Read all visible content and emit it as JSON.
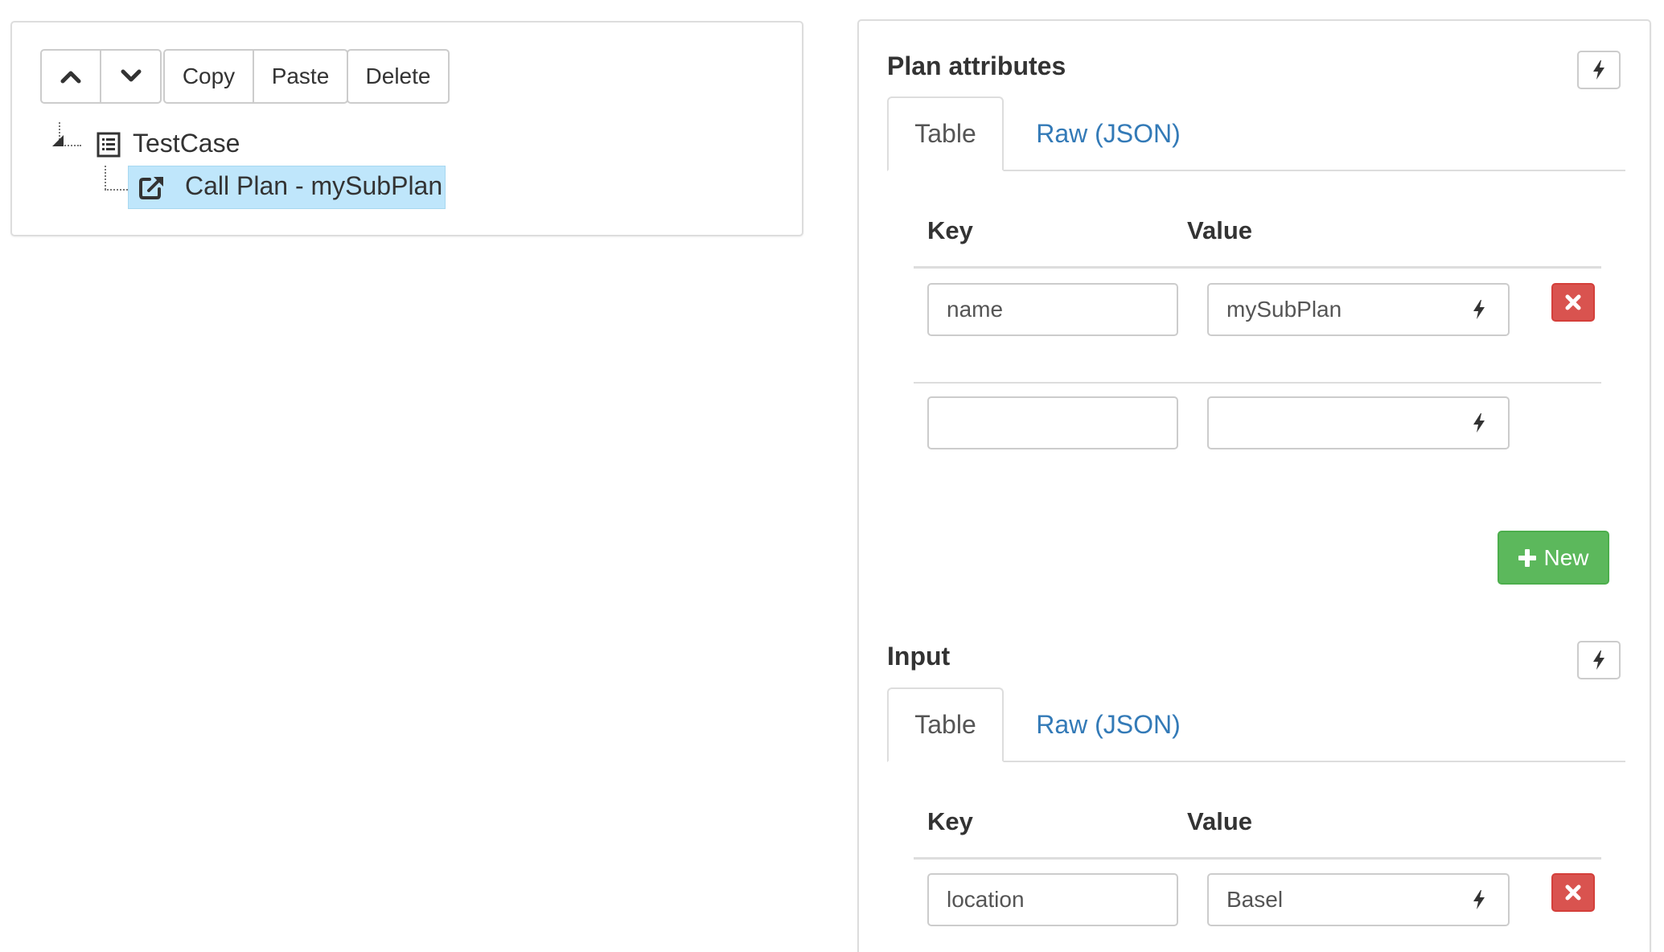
{
  "toolbar": {
    "up_icon": "chevron-up-icon",
    "down_icon": "chevron-down-icon",
    "copy_label": "Copy",
    "paste_label": "Paste",
    "delete_label": "Delete"
  },
  "tree": {
    "root": {
      "label": "TestCase",
      "icon": "list-icon"
    },
    "child": {
      "label": "Call Plan - mySubPlan",
      "icon": "external-link-icon",
      "selected": true,
      "highlight_color": "#bfe6fb"
    }
  },
  "plan_attributes": {
    "title": "Plan attributes",
    "tabs": [
      "Table",
      "Raw (JSON)"
    ],
    "active_tab": "Table",
    "headers": {
      "key": "Key",
      "value": "Value"
    },
    "rows": [
      {
        "key": "name",
        "value": "mySubPlan"
      },
      {
        "key": "",
        "value": ""
      }
    ],
    "new_label": "New"
  },
  "input": {
    "title": "Input",
    "tabs": [
      "Table",
      "Raw (JSON)"
    ],
    "active_tab": "Table",
    "headers": {
      "key": "Key",
      "value": "Value"
    },
    "rows": [
      {
        "key": "location",
        "value": "Basel"
      }
    ]
  },
  "colors": {
    "link": "#337ab7",
    "danger": "#d9534f",
    "success": "#5cb85c",
    "selection": "#bfe6fb"
  }
}
